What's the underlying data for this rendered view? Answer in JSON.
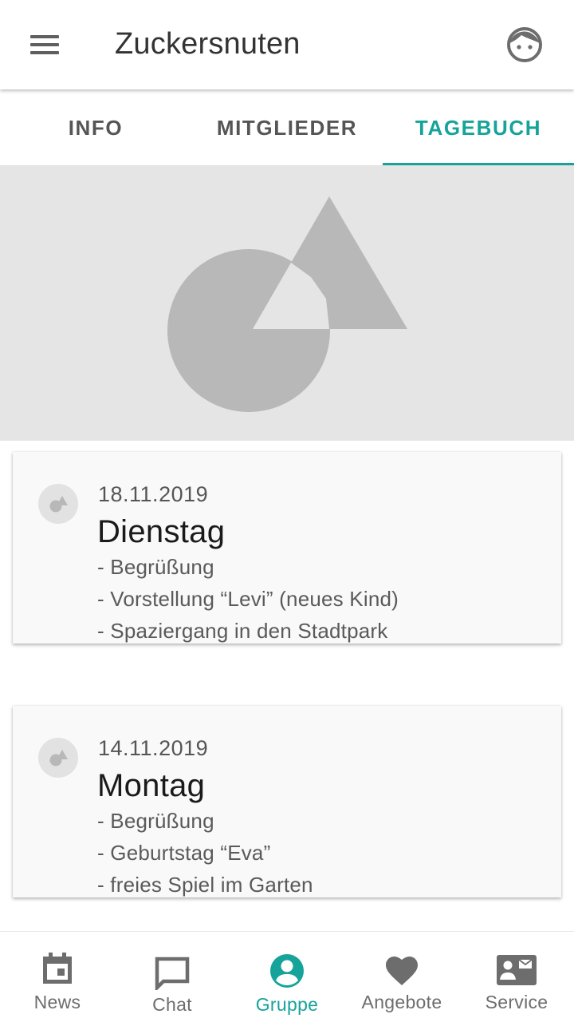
{
  "app_bar": {
    "title": "Zuckersnuten",
    "menu_icon": "menu-icon",
    "profile_icon": "child-face-icon"
  },
  "tabs": [
    {
      "label": "INFO",
      "active": false
    },
    {
      "label": "MITGLIEDER",
      "active": false
    },
    {
      "label": "TAGEBUCH",
      "active": true
    }
  ],
  "hero": {
    "icon": "image-placeholder-icon"
  },
  "entries": [
    {
      "date": "18.11.2019",
      "title": "Dienstag",
      "lines": [
        "- Begrüßung",
        "- Vorstellung “Levi” (neues Kind)",
        "- Spaziergang in den Stadtpark"
      ]
    },
    {
      "date": "14.11.2019",
      "title": "Montag",
      "lines": [
        "- Begrüßung",
        "- Geburtstag “Eva”",
        "- freies Spiel im Garten"
      ]
    }
  ],
  "bottom_nav": [
    {
      "label": "News",
      "icon": "calendar-icon",
      "active": false
    },
    {
      "label": "Chat",
      "icon": "chat-bubble-icon",
      "active": false
    },
    {
      "label": "Gruppe",
      "icon": "account-circle-icon",
      "active": true
    },
    {
      "label": "Angebote",
      "icon": "heart-icon",
      "active": false
    },
    {
      "label": "Service",
      "icon": "contact-mail-icon",
      "active": false
    }
  ],
  "colors": {
    "accent": "#16a39a",
    "icon_gray": "#6d6d6d",
    "placeholder_gray": "#b8b8b8",
    "hero_background": "#e5e5e5"
  }
}
